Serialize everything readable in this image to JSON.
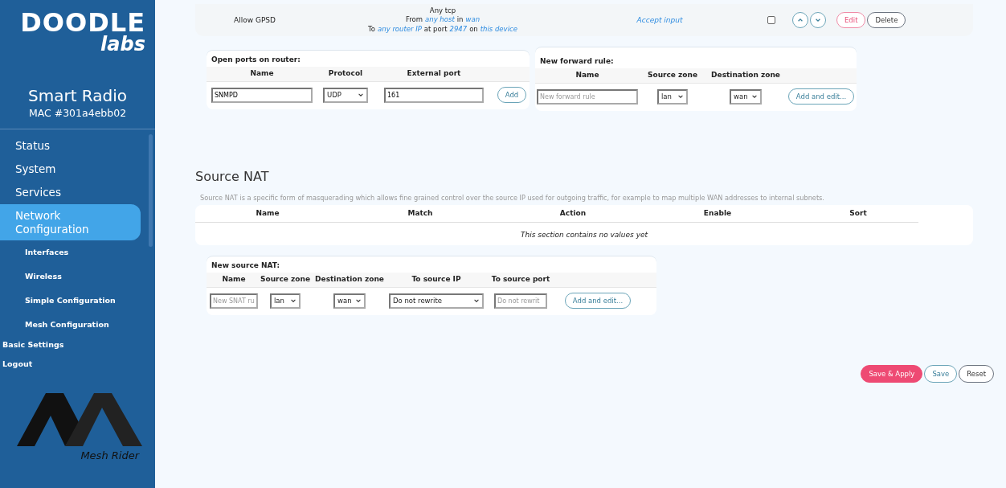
{
  "sidebar": {
    "logo": {
      "brand": "DOODLE",
      "sub": "labs"
    },
    "device": {
      "title": "Smart Radio",
      "mac": "MAC #301a4ebb02"
    },
    "items": [
      {
        "label": "Status",
        "selected": false,
        "kind": "main"
      },
      {
        "label": "System",
        "selected": false,
        "kind": "main"
      },
      {
        "label": "Services",
        "selected": false,
        "kind": "main"
      },
      {
        "label": "Network Configuration",
        "selected": true,
        "kind": "main"
      },
      {
        "label": "Interfaces",
        "selected": false,
        "kind": "sub"
      },
      {
        "label": "Wireless",
        "selected": false,
        "kind": "sub"
      },
      {
        "label": "Simple Configuration",
        "selected": false,
        "kind": "sub"
      },
      {
        "label": "Mesh Configuration",
        "selected": false,
        "kind": "sub"
      },
      {
        "label": "Basic Settings",
        "selected": false,
        "kind": "small"
      },
      {
        "label": "Logout",
        "selected": false,
        "kind": "small"
      }
    ],
    "footer_logo": {
      "text": "Mesh Rider"
    }
  },
  "rule_row": {
    "name": "Allow GPSD",
    "match": [
      [
        {
          "text": "Any tcp",
          "link": false
        }
      ],
      [
        {
          "text": "From",
          "link": false
        },
        {
          "text": "any host",
          "link": true
        },
        {
          "text": "in",
          "link": false
        },
        {
          "text": "wan",
          "link": true
        }
      ],
      [
        {
          "text": "To",
          "link": false
        },
        {
          "text": "any router IP",
          "link": true
        },
        {
          "text": "at port",
          "link": false
        },
        {
          "text": "2947",
          "link": true
        },
        {
          "text": "on",
          "link": false
        },
        {
          "text": "this device",
          "link": true
        }
      ]
    ],
    "action": "Accept input",
    "enabled": false,
    "buttons": [
      "Edit",
      "Delete"
    ]
  },
  "open_ports": {
    "title": "Open ports on router:",
    "columns": [
      "Name",
      "Protocol",
      "External port"
    ],
    "name_value": "SNMPD",
    "protocol": "UDP",
    "port_value": "161",
    "button": "Add"
  },
  "forward_rule": {
    "title": "New forward rule:",
    "columns": [
      "Name",
      "Source zone",
      "Destination zone"
    ],
    "name_placeholder": "New forward rule",
    "source_zone": "lan",
    "destination_zone": "wan",
    "button": "Add and edit..."
  },
  "source_nat": {
    "heading": "Source NAT",
    "description": "Source NAT is a specific form of masquerading which allows fine grained control over the source IP used for outgoing traffic, for example to map multiple WAN addresses to internal subnets.",
    "table": {
      "columns": [
        "Name",
        "Match",
        "Action",
        "Enable",
        "Sort"
      ],
      "empty": "This section contains no values yet"
    },
    "new": {
      "title": "New source NAT:",
      "columns": [
        "Name",
        "Source zone",
        "Destination zone",
        "To source IP",
        "To source port"
      ],
      "name_placeholder": "New SNAT ru",
      "source_zone": "lan",
      "destination_zone": "wan",
      "source_ip": "Do not rewrite",
      "port_placeholder": "Do not rewrit",
      "button": "Add and edit..."
    }
  },
  "actions": [
    "Save & Apply",
    "Save",
    "Reset"
  ]
}
